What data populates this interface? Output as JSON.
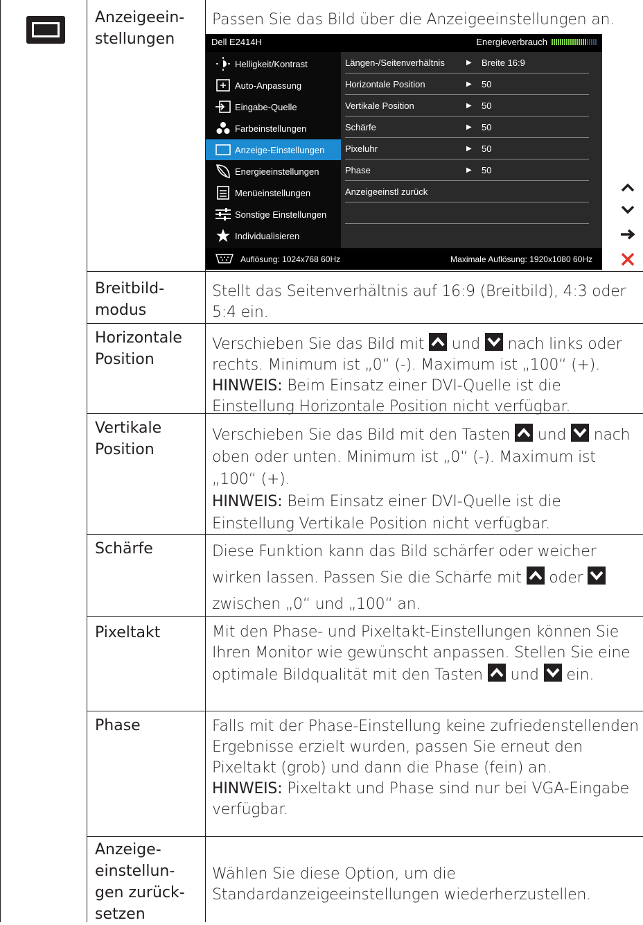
{
  "sections": [
    {
      "label": "Anzeigeein-\nstellungen",
      "desc": "Passen Sie das Bild über die Anzeigeeinstellungen an."
    },
    {
      "label": "Breitbild-\nmodus",
      "desc": "Stellt das Seitenverhältnis auf 16:9 (Breitbild), 4:3 oder 5:4 ein."
    },
    {
      "label": "Horizontale\nPosition",
      "desc_a": "Verschieben Sie das Bild mit",
      "desc_b": "und",
      "desc_c": "nach links oder rechts. Minimum ist „0“ (-). Maximum ist „100“ (+).",
      "note_label": "HINWEIS:",
      "note": "Beim Einsatz einer DVI-Quelle ist die Einstellung Horizontale Position nicht verfügbar."
    },
    {
      "label": "Vertikale\nPosition",
      "desc_a": "Verschieben Sie das Bild mit den Tasten",
      "desc_b": "und",
      "desc_c": "nach oben oder unten. Minimum ist „0“ (-). Maximum ist „100“ (+).",
      "note_label": "HINWEIS:",
      "note": "Beim Einsatz einer DVI-Quelle ist die Einstellung Vertikale Position nicht verfügbar."
    },
    {
      "label": "Schärfe",
      "desc_a": "Diese Funktion kann das Bild schärfer oder weicher wirken lassen. Passen Sie die Schärfe mit",
      "desc_b": "oder",
      "desc_c": "zwischen „0“ und „100“ an."
    },
    {
      "label": "Pixeltakt",
      "desc_a": "Mit den Phase- und Pixeltakt-Einstellungen können Sie Ihren Monitor wie gewünscht anpassen. Stellen Sie eine optimale Bildqualität mit den Tasten",
      "desc_b": "und",
      "desc_c": "ein."
    },
    {
      "label": "Phase",
      "desc": "Falls mit der Phase-Einstellung keine zufriedenstellenden Ergebnisse erzielt wurden, passen Sie erneut den Pixeltakt (grob) und dann die Phase (fein) an.",
      "note_label": "HINWEIS:",
      "note": "Pixeltakt und Phase sind nur bei VGA-Eingabe verfügbar."
    },
    {
      "label": "Anzeige-\neinstellun-\ngen zurück-\nsetzen",
      "desc": "Wählen Sie diese Option, um die Standardanzeigeeinstellungen wiederherzustellen."
    }
  ],
  "osd": {
    "model": "Dell E2414H",
    "energy_label": "Energieverbrauch",
    "energy_level": 0.78,
    "menu": [
      {
        "label": "Helligkeit/Kontrast",
        "icon": "brightness-icon"
      },
      {
        "label": "Auto-Anpassung",
        "icon": "auto-adjust-icon"
      },
      {
        "label": "Eingabe-Quelle",
        "icon": "input-source-icon"
      },
      {
        "label": "Farbeinstellungen",
        "icon": "color-icon"
      },
      {
        "label": "Anzeige-Einstellungen",
        "icon": "display-icon",
        "active": true
      },
      {
        "label": "Energieeinstellungen",
        "icon": "energy-icon"
      },
      {
        "label": "Menüeinstellungen",
        "icon": "menu-icon"
      },
      {
        "label": "Sonstige Einstellungen",
        "icon": "other-settings-icon"
      },
      {
        "label": "Individualisieren",
        "icon": "star-icon"
      }
    ],
    "rows": [
      {
        "name": "Längen-/Seitenverhältnis",
        "value": "Breite 16:9"
      },
      {
        "name": "Horizontale Position",
        "value": "50"
      },
      {
        "name": "Vertikale Position",
        "value": "50"
      },
      {
        "name": "Schärfe",
        "value": "50"
      },
      {
        "name": "Pixeluhr",
        "value": "50"
      },
      {
        "name": "Phase",
        "value": "50"
      },
      {
        "name": "Anzeigeeinstl zurück",
        "value": ""
      }
    ],
    "resolution_label": "Auflösung:",
    "resolution": "1024x768 60Hz",
    "max_resolution_label": "Maximale Auflösung:",
    "max_resolution": "1920x1080 60Hz"
  },
  "controls": [
    "up-icon",
    "down-icon",
    "right-arrow-icon",
    "close-icon"
  ],
  "colors": {
    "osd_active": "#1d8bd1",
    "close": "#e5322d",
    "text": "#231f20"
  }
}
